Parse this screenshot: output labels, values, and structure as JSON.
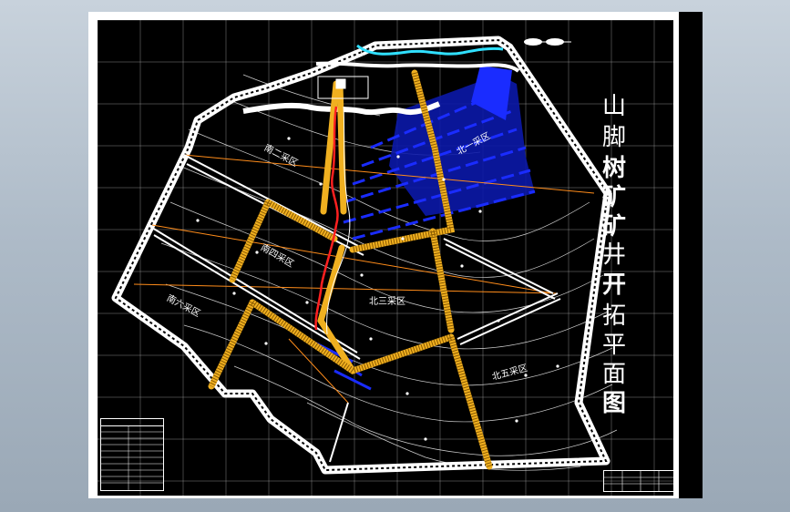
{
  "window": {
    "background_color": "#b4c0cc",
    "sheet_color": "#ffffff",
    "drawing_color": "#000000"
  },
  "drawing": {
    "title_chars": [
      "山",
      "脚",
      "树",
      "矿",
      "矿",
      "井",
      "开",
      "拓",
      "平",
      "面",
      "图"
    ],
    "zones": {
      "south_two": "南二采区",
      "north_one": "北一采区",
      "south_four": "南四采区",
      "north_three": "北三采区",
      "south_six": "南六采区",
      "north_five": "北五采区"
    },
    "colors": {
      "boundary": "#ffffff",
      "roadway": "#f0b020",
      "goaf": "#1a2cff",
      "river": "#30e0ff",
      "shaft_line": "#ff2020",
      "grid": "#ffffff",
      "contour": "#ffffff",
      "orange_line": "#ff8c1a"
    },
    "icons": {
      "legend": "legend-table-icon",
      "title_block": "title-block-icon",
      "scale_bar": "scale-bar-icon"
    }
  }
}
